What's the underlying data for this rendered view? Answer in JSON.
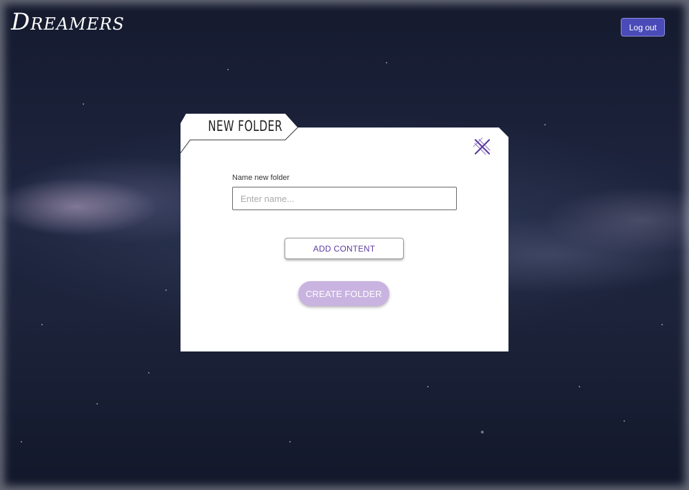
{
  "app": {
    "logo_text": "Dreamers"
  },
  "header": {
    "logout_label": "Log out"
  },
  "dialog": {
    "tab_title": "NEW FOLDER",
    "close_icon": "close-x-icon",
    "name_label": "Name new folder",
    "name_value": "",
    "name_placeholder": "Enter name...",
    "add_content_label": "ADD CONTENT",
    "create_folder_label": "CREATE FOLDER"
  },
  "colors": {
    "accent": "#4a4bb8",
    "accent_purple": "#5b3aa0",
    "create_button": "#c9b3e0",
    "background": "#1a2238"
  }
}
